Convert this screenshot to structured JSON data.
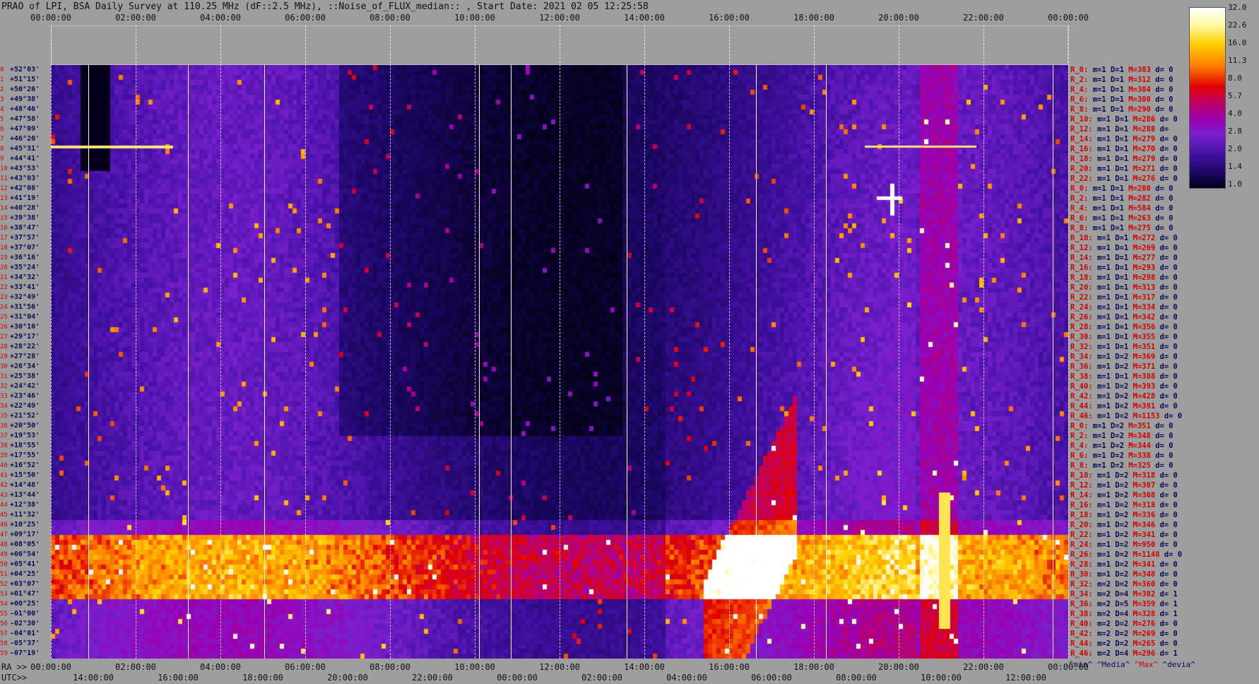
{
  "title": "PRAO of LPI, BSA Daily Survey at 110.25 MHz (dF::2.5 MHz), ::Noise_of_FLUX_median:: , Start Date: 2021 02 05 12:25:58",
  "top_axis": [
    "00:00:00",
    "02:00:00",
    "04:00:00",
    "06:00:00",
    "08:00:00",
    "10:00:00",
    "12:00:00",
    "14:00:00",
    "16:00:00",
    "18:00:00",
    "20:00:00",
    "22:00:00",
    "00:00:00"
  ],
  "bottom_axis_ra": {
    "prefix": "RA >>",
    "labels": [
      "00:00:00",
      "02:00:00",
      "04:00:00",
      "06:00:00",
      "08:00:00",
      "10:00:00",
      "12:00:00",
      "14:00:00",
      "16:00:00",
      "18:00:00",
      "20:00:00",
      "22:00:00",
      "00:00:00"
    ]
  },
  "bottom_axis_utc": {
    "prefix": "UTC>>",
    "labels": [
      "14:00:00",
      "16:00:00",
      "18:00:00",
      "20:00:00",
      "22:00:00",
      "00:00:00",
      "02:00:00",
      "04:00:00",
      "06:00:00",
      "08:00:00",
      "10:00:00",
      "12:00:00"
    ]
  },
  "row_labels": [
    {
      "idx": "0",
      "dec": "+52°03'"
    },
    {
      "idx": "1",
      "dec": "+51°15'"
    },
    {
      "idx": "2",
      "dec": "+50°26'"
    },
    {
      "idx": "3",
      "dec": "+49°38'"
    },
    {
      "idx": "4",
      "dec": "+48°46'"
    },
    {
      "idx": "5",
      "dec": "+47°58'"
    },
    {
      "idx": "6",
      "dec": "+47°09'"
    },
    {
      "idx": "7",
      "dec": "+46°20'"
    },
    {
      "idx": "8",
      "dec": "+45°31'"
    },
    {
      "idx": "9",
      "dec": "+44°41'"
    },
    {
      "idx": "10",
      "dec": "+43°53'"
    },
    {
      "idx": "11",
      "dec": "+43°03'"
    },
    {
      "idx": "12",
      "dec": "+42°08'"
    },
    {
      "idx": "13",
      "dec": "+41°19'"
    },
    {
      "idx": "14",
      "dec": "+40°28'"
    },
    {
      "idx": "15",
      "dec": "+39°38'"
    },
    {
      "idx": "16",
      "dec": "+38°47'"
    },
    {
      "idx": "17",
      "dec": "+37°57'"
    },
    {
      "idx": "18",
      "dec": "+37°07'"
    },
    {
      "idx": "19",
      "dec": "+36°16'"
    },
    {
      "idx": "20",
      "dec": "+35°24'"
    },
    {
      "idx": "21",
      "dec": "+34°32'"
    },
    {
      "idx": "22",
      "dec": "+33°41'"
    },
    {
      "idx": "23",
      "dec": "+32°49'"
    },
    {
      "idx": "24",
      "dec": "+31°56'"
    },
    {
      "idx": "25",
      "dec": "+31°04'"
    },
    {
      "idx": "26",
      "dec": "+30°10'"
    },
    {
      "idx": "27",
      "dec": "+29°17'"
    },
    {
      "idx": "28",
      "dec": "+28°22'"
    },
    {
      "idx": "29",
      "dec": "+27°28'"
    },
    {
      "idx": "30",
      "dec": "+26°34'"
    },
    {
      "idx": "31",
      "dec": "+25°38'"
    },
    {
      "idx": "32",
      "dec": "+24°42'"
    },
    {
      "idx": "33",
      "dec": "+23°46'"
    },
    {
      "idx": "34",
      "dec": "+22°49'"
    },
    {
      "idx": "35",
      "dec": "+21°52'"
    },
    {
      "idx": "36",
      "dec": "+20°50'"
    },
    {
      "idx": "37",
      "dec": "+19°53'"
    },
    {
      "idx": "38",
      "dec": "+18°55'"
    },
    {
      "idx": "39",
      "dec": "+17°55'"
    },
    {
      "idx": "40",
      "dec": "+16°52'"
    },
    {
      "idx": "41",
      "dec": "+15°50'"
    },
    {
      "idx": "42",
      "dec": "+14°48'"
    },
    {
      "idx": "43",
      "dec": "+13°44'"
    },
    {
      "idx": "44",
      "dec": "+12°38'"
    },
    {
      "idx": "45",
      "dec": "+11°32'"
    },
    {
      "idx": "46",
      "dec": "+10°25'"
    },
    {
      "idx": "47",
      "dec": "+09°17'"
    },
    {
      "idx": "48",
      "dec": "+08°05'"
    },
    {
      "idx": "49",
      "dec": "+06°54'"
    },
    {
      "idx": "50",
      "dec": "+05°41'"
    },
    {
      "idx": "51",
      "dec": "+04°25'"
    },
    {
      "idx": "52",
      "dec": "+03°07'"
    },
    {
      "idx": "53",
      "dec": "+01°47'"
    },
    {
      "idx": "54",
      "dec": "+00°25'"
    },
    {
      "idx": "55",
      "dec": "-01°00'"
    },
    {
      "idx": "56",
      "dec": "-02°30'"
    },
    {
      "idx": "57",
      "dec": "-04°01'"
    },
    {
      "idx": "58",
      "dec": "-05°37'"
    },
    {
      "idx": "59",
      "dec": "-07°19'"
    }
  ],
  "stats_rows": [
    {
      "name": "R_0:",
      "m": "m=1",
      "d": "D=1",
      "M": "M=303",
      "dd": "d= 0"
    },
    {
      "name": "R_2:",
      "m": "m=1",
      "d": "D=1",
      "M": "M=312",
      "dd": "d= 0"
    },
    {
      "name": "R_4:",
      "m": "m=1",
      "d": "D=1",
      "M": "M=304",
      "dd": "d= 0"
    },
    {
      "name": "R_6:",
      "m": "m=1",
      "d": "D=1",
      "M": "M=300",
      "dd": "d= 0"
    },
    {
      "name": "R_8:",
      "m": "m=1",
      "d": "D=1",
      "M": "M=290",
      "dd": "d= 0"
    },
    {
      "name": "R_10:",
      "m": "m=1",
      "d": "D=1",
      "M": "M=286",
      "dd": "d= 0"
    },
    {
      "name": "R_12:",
      "m": "m=1",
      "d": "D=1",
      "M": "M=288",
      "dd": "d="
    },
    {
      "name": "R_14:",
      "m": "m=1",
      "d": "D=1",
      "M": "M=279",
      "dd": "d= 0"
    },
    {
      "name": "R_16:",
      "m": "m=1",
      "d": "D=1",
      "M": "M=270",
      "dd": "d= 0"
    },
    {
      "name": "R_18:",
      "m": "m=1",
      "d": "D=1",
      "M": "M=279",
      "dd": "d= 0"
    },
    {
      "name": "R_20:",
      "m": "m=1",
      "d": "D=1",
      "M": "M=271",
      "dd": "d= 0"
    },
    {
      "name": "R_22:",
      "m": "m=1",
      "d": "D=1",
      "M": "M=276",
      "dd": "d= 0"
    },
    {
      "name": "R_0:",
      "m": "m=1",
      "d": "D=1",
      "M": "M=280",
      "dd": "d= 0"
    },
    {
      "name": "R_2:",
      "m": "m=1",
      "d": "D=1",
      "M": "M=282",
      "dd": "d= 0"
    },
    {
      "name": "R_4:",
      "m": "m=1",
      "d": "D=1",
      "M": "M=584",
      "dd": "d= 0"
    },
    {
      "name": "R_6:",
      "m": "m=1",
      "d": "D=1",
      "M": "M=263",
      "dd": "d= 0"
    },
    {
      "name": "R_8:",
      "m": "m=1",
      "d": "D=1",
      "M": "M=275",
      "dd": "d= 0"
    },
    {
      "name": "R_10:",
      "m": "m=1",
      "d": "D=1",
      "M": "M=272",
      "dd": "d= 0"
    },
    {
      "name": "R_12:",
      "m": "m=1",
      "d": "D=1",
      "M": "M=269",
      "dd": "d= 0"
    },
    {
      "name": "R_14:",
      "m": "m=1",
      "d": "D=1",
      "M": "M=277",
      "dd": "d= 0"
    },
    {
      "name": "R_16:",
      "m": "m=1",
      "d": "D=1",
      "M": "M=293",
      "dd": "d= 0"
    },
    {
      "name": "R_18:",
      "m": "m=1",
      "d": "D=1",
      "M": "M=298",
      "dd": "d= 0"
    },
    {
      "name": "R_20:",
      "m": "m=1",
      "d": "D=1",
      "M": "M=313",
      "dd": "d= 0"
    },
    {
      "name": "R_22:",
      "m": "m=1",
      "d": "D=1",
      "M": "M=317",
      "dd": "d= 0"
    },
    {
      "name": "R_24:",
      "m": "m=1",
      "d": "D=1",
      "M": "M=334",
      "dd": "d= 0"
    },
    {
      "name": "R_26:",
      "m": "m=1",
      "d": "D=1",
      "M": "M=342",
      "dd": "d= 0"
    },
    {
      "name": "R_28:",
      "m": "m=1",
      "d": "D=1",
      "M": "M=356",
      "dd": "d= 0"
    },
    {
      "name": "R_30:",
      "m": "m=1",
      "d": "D=1",
      "M": "M=355",
      "dd": "d= 0"
    },
    {
      "name": "R_32:",
      "m": "m=1",
      "d": "D=1",
      "M": "M=351",
      "dd": "d= 0"
    },
    {
      "name": "R_34:",
      "m": "m=1",
      "d": "D=2",
      "M": "M=369",
      "dd": "d= 0"
    },
    {
      "name": "R_36:",
      "m": "m=1",
      "d": "D=2",
      "M": "M=371",
      "dd": "d= 0"
    },
    {
      "name": "R_38:",
      "m": "m=1",
      "d": "D=1",
      "M": "M=388",
      "dd": "d= 0"
    },
    {
      "name": "R_40:",
      "m": "m=1",
      "d": "D=2",
      "M": "M=393",
      "dd": "d= 0"
    },
    {
      "name": "R_42:",
      "m": "m=1",
      "d": "D=2",
      "M": "M=428",
      "dd": "d= 0"
    },
    {
      "name": "R_44:",
      "m": "m=1",
      "d": "D=2",
      "M": "M=391",
      "dd": "d= 0"
    },
    {
      "name": "R_46:",
      "m": "m=1",
      "d": "D=2",
      "M": "M=1153",
      "dd": "d= 0"
    },
    {
      "name": "R_0:",
      "m": "m=1",
      "d": "D=2",
      "M": "M=351",
      "dd": "d= 0"
    },
    {
      "name": "R_2:",
      "m": "m=1",
      "d": "D=2",
      "M": "M=348",
      "dd": "d= 0"
    },
    {
      "name": "R_4:",
      "m": "m=1",
      "d": "D=2",
      "M": "M=344",
      "dd": "d= 0"
    },
    {
      "name": "R_6:",
      "m": "m=1",
      "d": "D=2",
      "M": "M=338",
      "dd": "d= 0"
    },
    {
      "name": "R_8:",
      "m": "m=1",
      "d": "D=2",
      "M": "M=325",
      "dd": "d= 0"
    },
    {
      "name": "R_10:",
      "m": "m=1",
      "d": "D=2",
      "M": "M=318",
      "dd": "d= 0"
    },
    {
      "name": "R_12:",
      "m": "m=1",
      "d": "D=2",
      "M": "M=307",
      "dd": "d= 0"
    },
    {
      "name": "R_14:",
      "m": "m=1",
      "d": "D=2",
      "M": "M=308",
      "dd": "d= 0"
    },
    {
      "name": "R_16:",
      "m": "m=1",
      "d": "D=2",
      "M": "M=318",
      "dd": "d= 0"
    },
    {
      "name": "R_18:",
      "m": "m=1",
      "d": "D=2",
      "M": "M=336",
      "dd": "d= 0"
    },
    {
      "name": "R_20:",
      "m": "m=1",
      "d": "D=2",
      "M": "M=346",
      "dd": "d= 0"
    },
    {
      "name": "R_22:",
      "m": "m=1",
      "d": "D=2",
      "M": "M=341",
      "dd": "d= 0"
    },
    {
      "name": "R_24:",
      "m": "m=1",
      "d": "D=2",
      "M": "M=950",
      "dd": "d= 0"
    },
    {
      "name": "R_26:",
      "m": "m=1",
      "d": "D=2",
      "M": "M=1148",
      "dd": "d= 0"
    },
    {
      "name": "R_28:",
      "m": "m=1",
      "d": "D=2",
      "M": "M=341",
      "dd": "d= 0"
    },
    {
      "name": "R_30:",
      "m": "m=1",
      "d": "D=2",
      "M": "M=348",
      "dd": "d= 0"
    },
    {
      "name": "R_32:",
      "m": "m=2",
      "d": "D=2",
      "M": "M=360",
      "dd": "d= 0"
    },
    {
      "name": "R_34:",
      "m": "m=2",
      "d": "D=4",
      "M": "M=382",
      "dd": "d= 1"
    },
    {
      "name": "R_36:",
      "m": "m=2",
      "d": "D=5",
      "M": "M=359",
      "dd": "d= 1"
    },
    {
      "name": "R_38:",
      "m": "m=2",
      "d": "D=4",
      "M": "M=328",
      "dd": "d= 1"
    },
    {
      "name": "R_40:",
      "m": "m=2",
      "d": "D=2",
      "M": "M=276",
      "dd": "d= 0"
    },
    {
      "name": "R_42:",
      "m": "m=2",
      "d": "D=2",
      "M": "M=269",
      "dd": "d= 0"
    },
    {
      "name": "R_44:",
      "m": "m=2",
      "d": "D=2",
      "M": "M=265",
      "dd": "d= 0"
    },
    {
      "name": "R_46:",
      "m": "m=2",
      "d": "D=4",
      "M": "M=296",
      "dd": "d= 1"
    }
  ],
  "legend": {
    "min": "^min^",
    "median": "^Media^",
    "max": "^Max^",
    "devia": "^devia^"
  },
  "colorbar_labels": [
    "32.0",
    "22.6",
    "16.0",
    "11.3",
    "8.0",
    "5.7",
    "4.0",
    "2.8",
    "2.0",
    "1.4",
    "1.0"
  ],
  "colors": {
    "background": "#9e9e9e",
    "red_text": "#d40000",
    "blue_text": "#0a0a5a"
  }
}
